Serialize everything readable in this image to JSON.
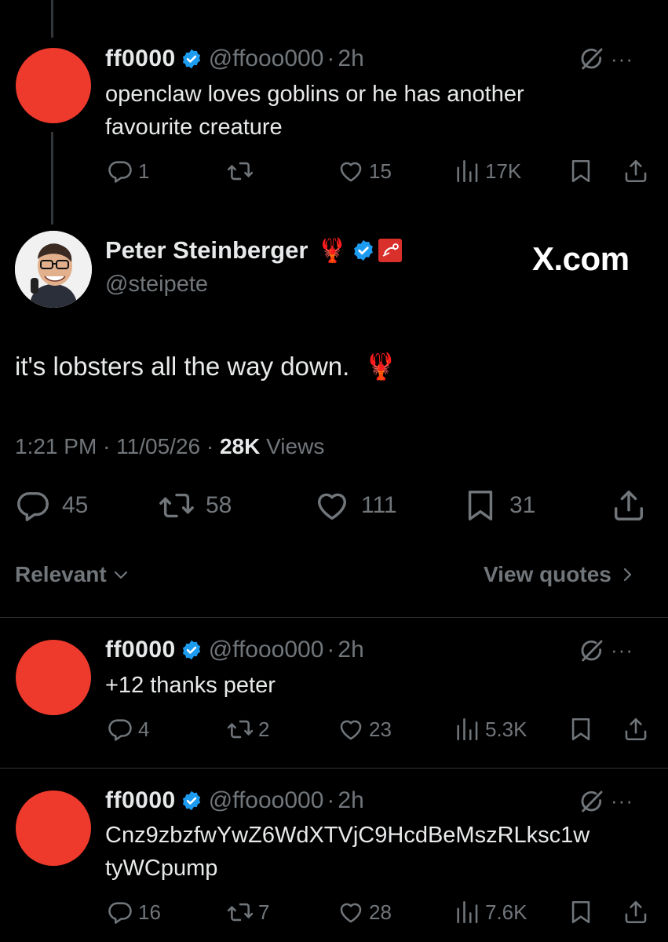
{
  "reply1": {
    "name": "ff0000",
    "handle": "@ffooo000",
    "time": "2h",
    "text_line1": "openclaw loves goblins or he has another",
    "text_line2": "favourite creature",
    "replies": "1",
    "reposts": "",
    "likes": "15",
    "views": "17K"
  },
  "main_tweet": {
    "name": "Peter Steinberger",
    "lobster_emoji": "🦞",
    "handle": "@steipete",
    "watermark": "X.com",
    "text": "it's lobsters all the way down.",
    "text_emoji": "🦞",
    "time": "1:21 PM",
    "date": "11/05/26",
    "views_count": "28K",
    "views_label": "Views",
    "replies": "45",
    "reposts": "58",
    "likes": "111",
    "bookmarks": "31"
  },
  "sort": {
    "label": "Relevant",
    "view_quotes": "View quotes"
  },
  "reply2": {
    "name": "ff0000",
    "handle": "@ffooo000",
    "time": "2h",
    "text_line1": "+12 thanks peter",
    "replies": "4",
    "reposts": "2",
    "likes": "23",
    "views": "5.3K"
  },
  "reply3": {
    "name": "ff0000",
    "handle": "@ffooo000",
    "time": "2h",
    "text_line1": "Cnz9zbzfwYwZ6WdXTVjC9HcdBeMszRLksc1w",
    "text_line2": "tyWCpump",
    "replies": "16",
    "reposts": "7",
    "likes": "28",
    "views": "7.6K"
  },
  "colors": {
    "background": "#000000",
    "text": "#e7e9ea",
    "muted": "#71767b",
    "verified": "#1d9bf0",
    "avatar_red": "#ee3a2c"
  }
}
